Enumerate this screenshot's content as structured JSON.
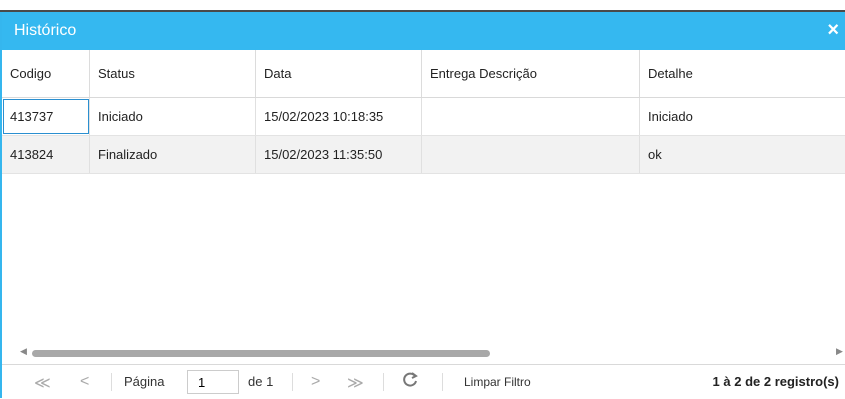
{
  "window": {
    "title": "Histórico",
    "close_label": "×"
  },
  "grid": {
    "columns": [
      "Codigo",
      "Status",
      "Data",
      "Entrega Descrição",
      "Detalhe"
    ],
    "rows": [
      [
        "413737",
        "Iniciado",
        "15/02/2023 10:18:35",
        "",
        "Iniciado"
      ],
      [
        "413824",
        "Finalizado",
        "15/02/2023 11:35:50",
        "",
        "ok"
      ]
    ]
  },
  "pager": {
    "first": "≪",
    "prev": "<",
    "next": ">",
    "last": "≫",
    "page_label": "Página",
    "page_value": "1",
    "of_label": "de 1",
    "clear_filter": "Limpar Filtro",
    "record_count": "1 à 2 de 2 registro(s)"
  }
}
